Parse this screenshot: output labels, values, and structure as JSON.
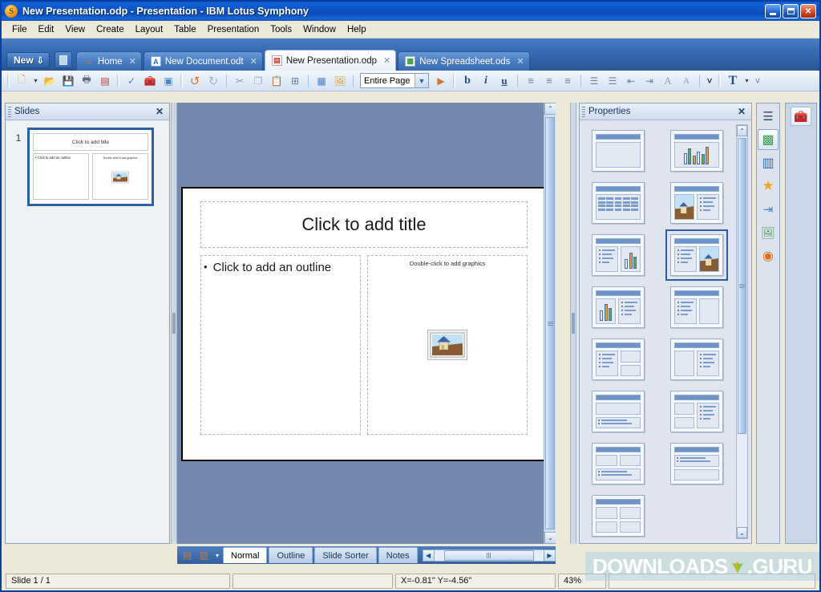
{
  "window": {
    "title": "New Presentation.odp - Presentation - IBM Lotus Symphony",
    "logo": "symphony-logo",
    "minimize": "_",
    "maximize": "□",
    "close": "✕"
  },
  "menubar": {
    "items": [
      "File",
      "Edit",
      "View",
      "Create",
      "Layout",
      "Table",
      "Presentation",
      "Tools",
      "Window",
      "Help"
    ]
  },
  "tabbar": {
    "new_label": "New",
    "new_dropdown": "⇩",
    "tabs": [
      {
        "label": "Home",
        "icon": "home-icon",
        "icon_char": "⌂",
        "icon_color": "#e07b1e",
        "active": false,
        "closable": true
      },
      {
        "label": "New Document.odt",
        "icon": "document-icon",
        "icon_char": "A",
        "icon_color": "#2b6fd4",
        "active": false,
        "closable": true
      },
      {
        "label": "New Presentation.odp",
        "icon": "presentation-icon",
        "icon_char": "▤",
        "icon_color": "#c1433a",
        "active": true,
        "closable": true
      },
      {
        "label": "New Spreadsheet.ods",
        "icon": "spreadsheet-icon",
        "icon_char": "▦",
        "icon_color": "#3d9a3d",
        "active": false,
        "closable": true
      }
    ]
  },
  "toolbar": {
    "items": [
      {
        "name": "new-icon",
        "char": "🗋",
        "color": "#d99a2b"
      },
      {
        "name": "new-dropdown-icon",
        "char": "▾",
        "color": "#444"
      },
      {
        "name": "open-icon",
        "char": "📂",
        "color": "#e0a63a"
      },
      {
        "name": "save-icon",
        "char": "💾",
        "color": "#d4762a"
      },
      {
        "name": "print-icon",
        "char": "🖶",
        "color": "#5b6b7c"
      },
      {
        "name": "export-pdf-icon",
        "char": "▤",
        "color": "#c63b2e"
      },
      {
        "name": "spellcheck-icon",
        "char": "✓",
        "color": "#4a7fc8"
      },
      {
        "name": "presentation-kit-icon",
        "char": "🧰",
        "color": "#d99a2b"
      },
      {
        "name": "slide-show-icon",
        "char": "▣",
        "color": "#4a7fc8"
      },
      {
        "name": "undo-icon",
        "char": "↺",
        "color": "#d4762a"
      },
      {
        "name": "redo-icon",
        "char": "↻",
        "color": "#9bb4cc"
      },
      {
        "name": "cut-icon",
        "char": "✂",
        "color": "#8a99a8"
      },
      {
        "name": "copy-icon",
        "char": "❐",
        "color": "#9bb4cc"
      },
      {
        "name": "paste-icon",
        "char": "📋",
        "color": "#d99a2b"
      },
      {
        "name": "textbox-icon",
        "char": "⊞",
        "color": "#5b7ea8"
      },
      {
        "name": "table-icon",
        "char": "▦",
        "color": "#4a7fc8"
      },
      {
        "name": "insert-picture-icon",
        "char": "🖼",
        "color": "#d99a2b"
      }
    ],
    "zoom_select": {
      "value": "Entire Page",
      "caret": "▼"
    },
    "after_items": [
      {
        "name": "start-slideshow-icon",
        "char": "▶",
        "color": "#d4762a"
      },
      {
        "name": "bold-icon",
        "char": "b",
        "color": "#27497f"
      },
      {
        "name": "italic-icon",
        "char": "i",
        "color": "#27497f"
      },
      {
        "name": "underline-icon",
        "char": "u",
        "color": "#27497f"
      },
      {
        "name": "align-left-icon",
        "char": "≡",
        "color": "#6a86a8"
      },
      {
        "name": "align-center-icon",
        "char": "≡",
        "color": "#6a86a8"
      },
      {
        "name": "align-right-icon",
        "char": "≡",
        "color": "#6a86a8"
      },
      {
        "name": "bullet-list-icon",
        "char": "⋮≡",
        "color": "#6a86a8"
      },
      {
        "name": "numbered-list-icon",
        "char": "⋮≡",
        "color": "#6a86a8"
      },
      {
        "name": "decrease-indent-icon",
        "char": "⇤",
        "color": "#6a86a8"
      },
      {
        "name": "increase-indent-icon",
        "char": "⇥",
        "color": "#6a86a8"
      },
      {
        "name": "increase-font-icon",
        "char": "A",
        "color": "#8a9bb0"
      },
      {
        "name": "decrease-font-icon",
        "char": "A",
        "color": "#8a9bb0"
      },
      {
        "name": "toolbar-overflow-icon",
        "char": "˅",
        "color": "#6a86a8"
      },
      {
        "name": "text-properties-icon",
        "char": "T",
        "color": "#27497f"
      },
      {
        "name": "text-dropdown-icon",
        "char": "▾",
        "color": "#444"
      },
      {
        "name": "toolbar-overflow2-icon",
        "char": "˅",
        "color": "#6a86a8"
      }
    ]
  },
  "slides_panel": {
    "title": "Slides",
    "close": "✕",
    "slides": [
      {
        "number": "1",
        "title_text": "Click to add title",
        "outline_text": "Click to add an outline",
        "graphics_caption": "Double-click to add graphics",
        "selected": true
      }
    ]
  },
  "slide_editor": {
    "title_placeholder": "Click to add title",
    "outline_placeholder": "Click to add an outline",
    "outline_bullet": "•",
    "graphics_placeholder": "Double-click to add graphics",
    "graphics_icon": "image-placeholder-icon"
  },
  "properties_panel": {
    "title": "Properties",
    "close": "✕",
    "scroll_up": "⌃",
    "scroll_down": "⌄",
    "layouts": [
      {
        "id": "title-only",
        "kind": "blank",
        "selected": false
      },
      {
        "id": "title-chart",
        "kind": "chart",
        "selected": false
      },
      {
        "id": "title-table",
        "kind": "table",
        "selected": false
      },
      {
        "id": "title-graphic-text",
        "kind": "pic-text",
        "selected": false
      },
      {
        "id": "title-text-chart",
        "kind": "text-chart",
        "selected": false
      },
      {
        "id": "title-text-graphic",
        "kind": "text-pic",
        "selected": true
      },
      {
        "id": "title-chart-text",
        "kind": "chart-text",
        "selected": false
      },
      {
        "id": "title-text-box",
        "kind": "text-box",
        "selected": false
      },
      {
        "id": "title-text-2boxes",
        "kind": "text-2box",
        "selected": false
      },
      {
        "id": "title-box-text",
        "kind": "box-text",
        "selected": false
      },
      {
        "id": "title-box-over-text",
        "kind": "box-over-text",
        "selected": false
      },
      {
        "id": "title-2box-text",
        "kind": "twobox-text",
        "selected": false
      },
      {
        "id": "title-2boxes-text",
        "kind": "boxes-text",
        "selected": false
      },
      {
        "id": "title-text-over-box",
        "kind": "text-over-box",
        "selected": false
      },
      {
        "id": "title-four-boxes",
        "kind": "four-box",
        "selected": false
      }
    ]
  },
  "icon_rail": {
    "items": [
      {
        "name": "properties-icon",
        "char": "☰",
        "color": "#33516f",
        "active": false
      },
      {
        "name": "styles-3d-icon",
        "char": "▧",
        "color": "#3a9e4a",
        "active": true
      },
      {
        "name": "chart-icon",
        "char": "▥",
        "color": "#2f6fb5",
        "active": false
      },
      {
        "name": "effects-star-icon",
        "char": "★",
        "color": "#f0a81e",
        "active": false
      },
      {
        "name": "transitions-icon",
        "char": "⇥",
        "color": "#4a7fc8",
        "active": false
      },
      {
        "name": "gallery-icon",
        "char": "🖼",
        "color": "#4a9c5a",
        "active": false
      },
      {
        "name": "navigator-icon",
        "char": "◉",
        "color": "#e0721a",
        "active": false
      }
    ],
    "far_items": [
      {
        "name": "toolbox-icon",
        "char": "🧰",
        "color": "#d99a2b"
      }
    ]
  },
  "view_bar": {
    "icons": [
      {
        "name": "normal-view-icon",
        "char": "▤",
        "color": "#d4762a"
      },
      {
        "name": "master-view-icon",
        "char": "▥",
        "color": "#d4762a"
      },
      {
        "name": "view-dropdown-icon",
        "char": "▾",
        "color": "#ffffff"
      }
    ],
    "tabs": [
      {
        "label": "Normal",
        "active": true
      },
      {
        "label": "Outline",
        "active": false
      },
      {
        "label": "Slide Sorter",
        "active": false
      },
      {
        "label": "Notes",
        "active": false
      }
    ],
    "scroll_left": "◀",
    "scroll_right": "▶"
  },
  "status_bar": {
    "slide_counter": "Slide 1 / 1",
    "middle": "",
    "coordinates": "X=-0.81\" Y=-4.56\"",
    "zoom": "43%"
  },
  "watermark": {
    "text_left": "DOWNLOADS",
    "text_right": ".GURU"
  },
  "colors": {
    "titlebar_blue": "#0b53c4",
    "canvas_bg": "#7389b0",
    "panel_bg": "#dfe4ee",
    "accent_blue": "#2c5fa8",
    "status_bg": "#ece9d8"
  }
}
